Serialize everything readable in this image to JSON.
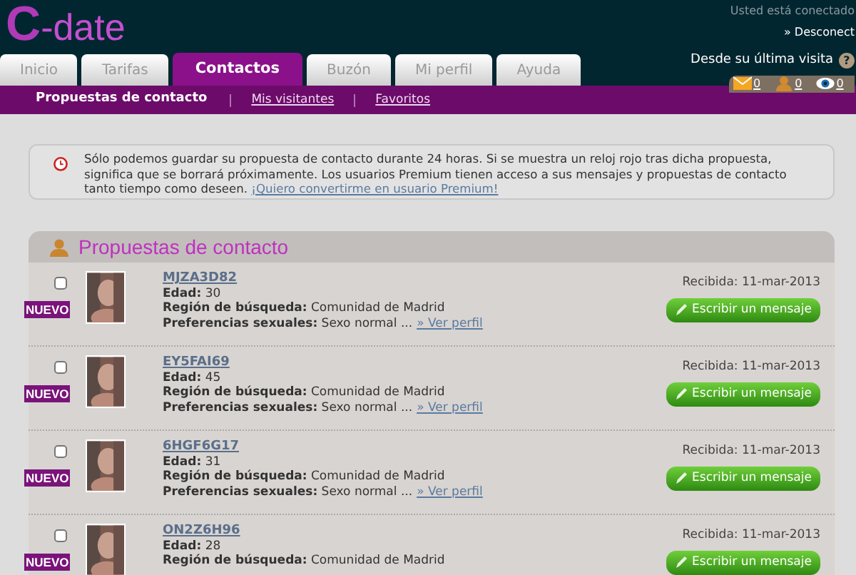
{
  "header": {
    "logo_mark": "C",
    "logo_text": "-date"
  },
  "session": {
    "status": "Usted está conectado",
    "logout": "» Desconect",
    "since_label": "Desde su última visita",
    "help": "?",
    "counters": [
      {
        "kind": "mail",
        "count": "0"
      },
      {
        "kind": "person",
        "count": "0"
      },
      {
        "kind": "eye",
        "count": "0"
      }
    ]
  },
  "tabs": [
    {
      "label": "Inicio",
      "selected": false
    },
    {
      "label": "Tarifas",
      "selected": false
    },
    {
      "label": "Contactos",
      "selected": true
    },
    {
      "label": "Buzón",
      "selected": false
    },
    {
      "label": "Mi perfil",
      "selected": false
    },
    {
      "label": "Ayuda",
      "selected": false
    }
  ],
  "subnav": [
    {
      "label": "Propuestas de contacto",
      "selected": true
    },
    {
      "label": "Mis visitantes",
      "selected": false
    },
    {
      "label": "Favoritos",
      "selected": false
    }
  ],
  "notice": {
    "text": "Sólo podemos guardar su propuesta de contacto durante 24 horas. Si se muestra un reloj rojo tras dicha propuesta, significa que se borrará próximamente. Los usuarios Premium tienen acceso a sus mensajes y propuestas de contacto tanto tiempo como deseen.",
    "link": "¡Quiero convertirme en usuario Premium!"
  },
  "panel": {
    "title": "Propuestas de contacto",
    "rows": [
      {
        "checked": false,
        "badge": "NUEVO",
        "name": "MJZA3D82",
        "age_label": "Edad:",
        "age": "30",
        "region_label": "Región de búsqueda:",
        "region": "Comunidad de Madrid",
        "prefs_label": "Preferencias sexuales:",
        "prefs": "Sexo normal ...",
        "profile_link": "» Ver perfil",
        "received": "Recibida: 11-mar-2013",
        "button": "Escribir un mensaje"
      },
      {
        "checked": false,
        "badge": "NUEVO",
        "name": "EY5FAI69",
        "age_label": "Edad:",
        "age": "45",
        "region_label": "Región de búsqueda:",
        "region": "Comunidad de Madrid",
        "prefs_label": "Preferencias sexuales:",
        "prefs": "Sexo normal ...",
        "profile_link": "» Ver perfil",
        "received": "Recibida: 11-mar-2013",
        "button": "Escribir un mensaje"
      },
      {
        "checked": false,
        "badge": "NUEVO",
        "name": "6HGF6G17",
        "age_label": "Edad:",
        "age": "31",
        "region_label": "Región de búsqueda:",
        "region": "Comunidad de Madrid",
        "prefs_label": "Preferencias sexuales:",
        "prefs": "Sexo normal ...",
        "profile_link": "» Ver perfil",
        "received": "Recibida: 11-mar-2013",
        "button": "Escribir un mensaje"
      },
      {
        "checked": false,
        "badge": "NUEVO",
        "name": "ON2Z6H96",
        "age_label": "Edad:",
        "age": "28",
        "region_label": "Región de búsqueda:",
        "region": "Comunidad de Madrid",
        "received": "Recibida: 11-mar-2013",
        "button": "Escribir un mensaje"
      }
    ]
  }
}
